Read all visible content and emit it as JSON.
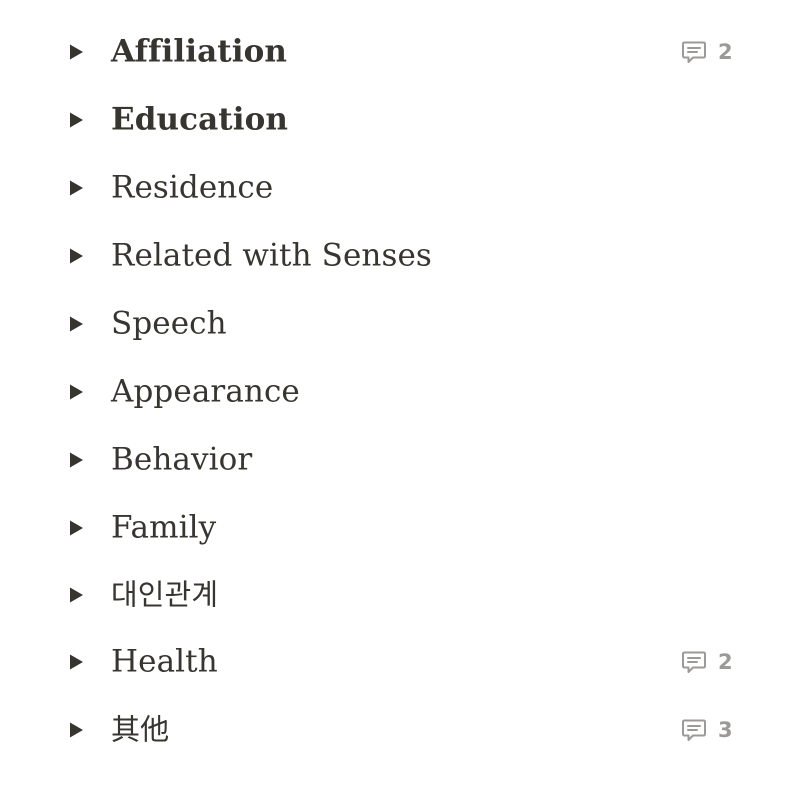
{
  "colors": {
    "text": "#37352f",
    "muted": "#9b9a97",
    "background": "#ffffff"
  },
  "toggle_icon": "triangle-right-icon",
  "comment_icon": "comment-icon",
  "items": [
    {
      "label": "Affiliation",
      "bold": true,
      "comments": "2"
    },
    {
      "label": "Education",
      "bold": true,
      "comments": null
    },
    {
      "label": "Residence",
      "bold": false,
      "comments": null
    },
    {
      "label": "Related with Senses",
      "bold": false,
      "comments": null
    },
    {
      "label": "Speech",
      "bold": false,
      "comments": null
    },
    {
      "label": "Appearance",
      "bold": false,
      "comments": null
    },
    {
      "label": "Behavior",
      "bold": false,
      "comments": null
    },
    {
      "label": "Family",
      "bold": false,
      "comments": null
    },
    {
      "label": "대인관계",
      "bold": false,
      "comments": null
    },
    {
      "label": "Health",
      "bold": false,
      "comments": "2"
    },
    {
      "label": "其他",
      "bold": false,
      "comments": "3"
    }
  ]
}
